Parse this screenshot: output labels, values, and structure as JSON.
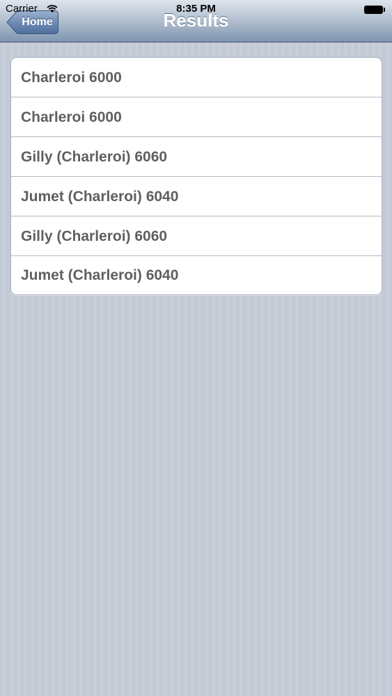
{
  "status_bar": {
    "carrier": "Carrier",
    "time": "8:35 PM"
  },
  "nav_bar": {
    "title": "Results",
    "back_label": "Home"
  },
  "results": [
    {
      "label": "Charleroi 6000"
    },
    {
      "label": "Charleroi 6000"
    },
    {
      "label": "Gilly (Charleroi) 6060"
    },
    {
      "label": "Jumet (Charleroi) 6040"
    },
    {
      "label": "Gilly (Charleroi) 6060"
    },
    {
      "label": "Jumet (Charleroi) 6040"
    }
  ],
  "icons": {
    "wifi": "wifi-icon",
    "battery": "battery-icon",
    "back": "back-chevron-button-shape"
  },
  "colors": {
    "nav_bar_top": "#dfe5ec",
    "nav_bar_bottom": "#7f95b0",
    "back_button": "#6f8cb5",
    "list_text": "#5f5f5f",
    "background": "#c5ccd6"
  }
}
